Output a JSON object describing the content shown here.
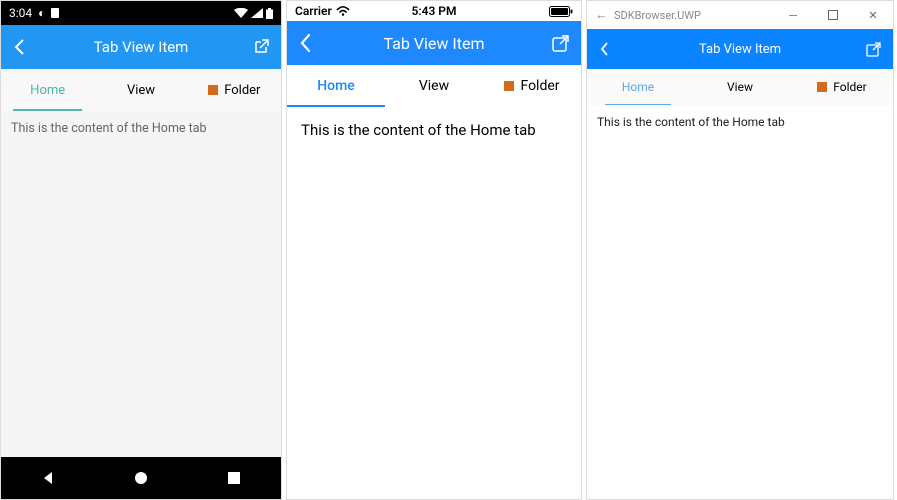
{
  "android": {
    "statusbar": {
      "time": "3:04"
    },
    "header": {
      "title": "Tab View Item"
    },
    "tabs": [
      {
        "label": "Home",
        "active": true
      },
      {
        "label": "View"
      },
      {
        "label": "Folder",
        "icon": true
      }
    ],
    "content": "This is the content of the Home tab"
  },
  "ios": {
    "statusbar": {
      "carrier": "Carrier",
      "time": "5:43 PM"
    },
    "header": {
      "title": "Tab View Item"
    },
    "tabs": [
      {
        "label": "Home",
        "active": true
      },
      {
        "label": "View"
      },
      {
        "label": "Folder",
        "icon": true
      }
    ],
    "content": "This is the content of the Home tab"
  },
  "uwp": {
    "titlebar": {
      "title": "SDKBrowser.UWP"
    },
    "header": {
      "title": "Tab View Item"
    },
    "tabs": [
      {
        "label": "Home",
        "active": true
      },
      {
        "label": "View"
      },
      {
        "label": "Folder",
        "icon": true
      }
    ],
    "content": "This is the content of the Home tab"
  }
}
